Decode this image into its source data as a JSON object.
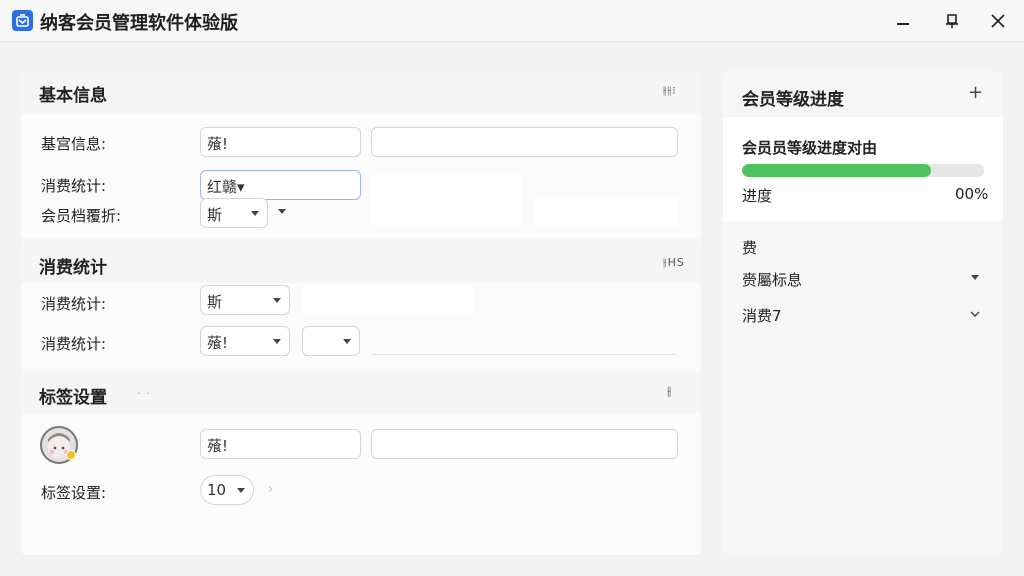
{
  "window": {
    "title": "纳客会员管理软件体验版",
    "icons": {
      "app": "app-logo-icon",
      "minimize": "minimize-icon",
      "pin": "pin-icon",
      "close": "close-icon"
    }
  },
  "basic": {
    "title": "基本信息",
    "tool": "⫲⫲⁝",
    "rows": [
      {
        "label": "基宫信息:",
        "value1": "蕵!",
        "value2": ""
      },
      {
        "label": "消费统计:",
        "value1": "红赣▾",
        "value2": ""
      },
      {
        "label": "会员档覆折:",
        "select": "斯",
        "value2": "",
        "value3": ""
      }
    ]
  },
  "consume": {
    "title": "消费统计",
    "tool": "⫲HS",
    "rows": [
      {
        "label": "消费统计:",
        "select": "斯",
        "value": ""
      },
      {
        "label": "消费统计:",
        "select": "蕵!",
        "select2": ""
      }
    ]
  },
  "tags": {
    "title": "标签设置",
    "tool": "⫲",
    "dots": "· ·",
    "row1": {
      "value1": "蕵!",
      "value2": ""
    },
    "row2": {
      "label": "标签设置:",
      "select": "10",
      "after": "›"
    }
  },
  "level": {
    "title": "会员等级进度",
    "plus": "+",
    "card_title": "会员员等级进度对由",
    "progress_label": "进度",
    "progress_value": "00%",
    "progress_fraction": 0.78,
    "progress_color": "#4fc360",
    "section_label": "费",
    "items": [
      {
        "label": "赍屬标息"
      },
      {
        "label": "消费7"
      }
    ]
  }
}
